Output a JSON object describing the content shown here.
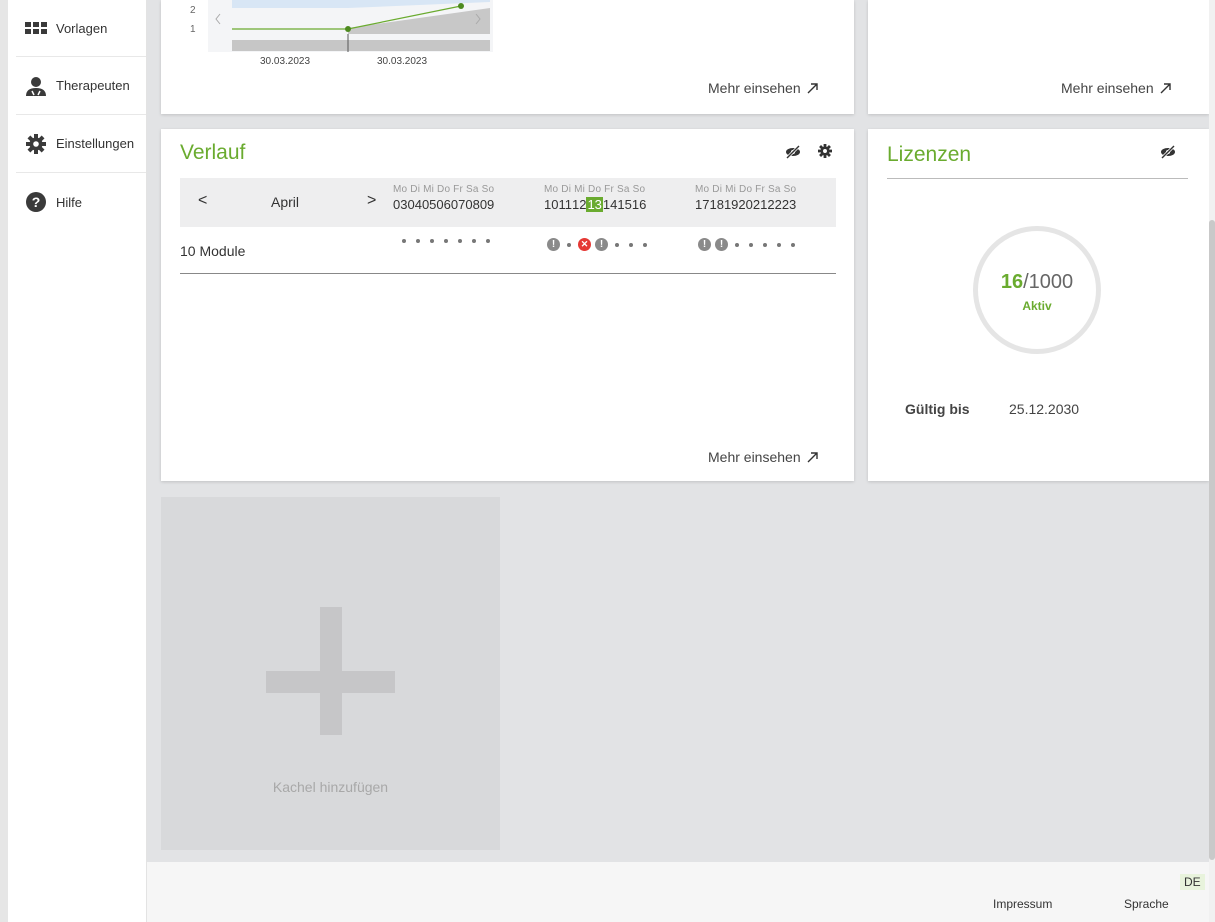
{
  "sidebar": {
    "items": [
      {
        "label": "Vorlagen",
        "icon": "grid-icon"
      },
      {
        "label": "Therapeuten",
        "icon": "person-icon"
      },
      {
        "label": "Einstellungen",
        "icon": "gear-icon"
      },
      {
        "label": "Hilfe",
        "icon": "help-icon"
      }
    ]
  },
  "top_chart": {
    "y_ticks": [
      "2",
      "1"
    ],
    "x_labels": [
      "30.03.2023",
      "30.03.2023"
    ],
    "more_label": "Mehr einsehen"
  },
  "top_right_card": {
    "more_label": "Mehr einsehen"
  },
  "verlauf": {
    "title": "Verlauf",
    "month": "April",
    "weeks": [
      {
        "days": "Mo Di Mi Do Fr Sa So",
        "dates": [
          "03",
          "04",
          "05",
          "06",
          "07",
          "08",
          "09"
        ]
      },
      {
        "days": "Mo Di Mi Do Fr Sa So",
        "dates": [
          "10",
          "11",
          "12",
          "13",
          "14",
          "15",
          "16"
        ]
      },
      {
        "days": "Mo Di Mi Do Fr Sa So",
        "dates": [
          "17",
          "18",
          "19",
          "20",
          "21",
          "22",
          "23"
        ]
      }
    ],
    "today": "13",
    "row_label": "10 Module",
    "more_label": "Mehr einsehen"
  },
  "lizenzen": {
    "title": "Lizenzen",
    "used": "16",
    "total": "/1000",
    "status": "Aktiv",
    "valid_label": "Gültig bis",
    "valid_date": "25.12.2030",
    "accent": "#6aab2f"
  },
  "add_tile": {
    "label": "Kachel hinzufügen"
  },
  "footer": {
    "impressum": "Impressum",
    "sprache": "Sprache",
    "lang": "DE"
  }
}
